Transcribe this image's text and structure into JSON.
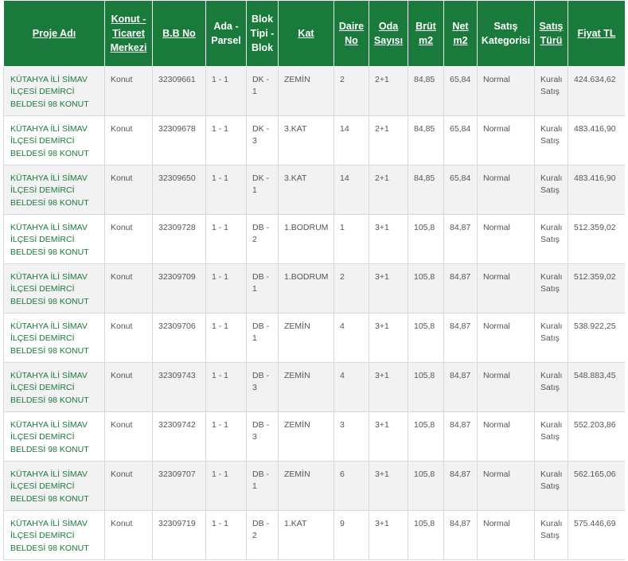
{
  "headers": [
    {
      "key": "proje_adi",
      "label": "Proje Adı",
      "sortable": true
    },
    {
      "key": "konut_ticaret",
      "label": "Konut - Ticaret Merkezi",
      "sortable": true
    },
    {
      "key": "bb_no",
      "label": "B.B No",
      "sortable": true
    },
    {
      "key": "ada_parsel",
      "label": "Ada - Parsel",
      "sortable": false
    },
    {
      "key": "blok",
      "label": "Blok Tipi - Blok",
      "sortable": false
    },
    {
      "key": "kat",
      "label": "Kat",
      "sortable": true
    },
    {
      "key": "daire_no",
      "label": "Daire No",
      "sortable": true
    },
    {
      "key": "oda",
      "label": "Oda Sayısı",
      "sortable": true
    },
    {
      "key": "brut",
      "label": "Brüt m2",
      "sortable": true
    },
    {
      "key": "net",
      "label": "Net m2",
      "sortable": true
    },
    {
      "key": "satis_kat",
      "label": "Satış Kategorisi",
      "sortable": false
    },
    {
      "key": "satis_turu",
      "label": "Satış Türü",
      "sortable": true
    },
    {
      "key": "fiyat",
      "label": "Fiyat TL",
      "sortable": true
    }
  ],
  "rows": [
    {
      "proje_adi": "KÜTAHYA İLİ SİMAV İLÇESİ DEMİRCİ BELDESİ 98 KONUT",
      "konut_ticaret": "Konut",
      "bb_no": "32309661",
      "ada_parsel": "1 - 1",
      "blok": "DK - 1",
      "kat": "ZEMİN",
      "daire_no": "2",
      "oda": "2+1",
      "brut": "84,85",
      "net": "65,84",
      "satis_kat": "Normal",
      "satis_turu": "Kuralı Satış",
      "fiyat": "424.634,62"
    },
    {
      "proje_adi": "KÜTAHYA İLİ SİMAV İLÇESİ DEMİRCİ BELDESİ 98 KONUT",
      "konut_ticaret": "Konut",
      "bb_no": "32309678",
      "ada_parsel": "1 - 1",
      "blok": "DK - 3",
      "kat": "3.KAT",
      "daire_no": "14",
      "oda": "2+1",
      "brut": "84,85",
      "net": "65,84",
      "satis_kat": "Normal",
      "satis_turu": "Kuralı Satış",
      "fiyat": "483.416,90"
    },
    {
      "proje_adi": "KÜTAHYA İLİ SİMAV İLÇESİ DEMİRCİ BELDESİ 98 KONUT",
      "konut_ticaret": "Konut",
      "bb_no": "32309650",
      "ada_parsel": "1 - 1",
      "blok": "DK - 1",
      "kat": "3.KAT",
      "daire_no": "14",
      "oda": "2+1",
      "brut": "84,85",
      "net": "65,84",
      "satis_kat": "Normal",
      "satis_turu": "Kuralı Satış",
      "fiyat": "483.416,90"
    },
    {
      "proje_adi": "KÜTAHYA İLİ SİMAV İLÇESİ DEMİRCİ BELDESİ 98 KONUT",
      "konut_ticaret": "Konut",
      "bb_no": "32309728",
      "ada_parsel": "1 - 1",
      "blok": "DB - 2",
      "kat": "1.BODRUM",
      "daire_no": "1",
      "oda": "3+1",
      "brut": "105,8",
      "net": "84,87",
      "satis_kat": "Normal",
      "satis_turu": "Kuralı Satış",
      "fiyat": "512.359,02"
    },
    {
      "proje_adi": "KÜTAHYA İLİ SİMAV İLÇESİ DEMİRCİ BELDESİ 98 KONUT",
      "konut_ticaret": "Konut",
      "bb_no": "32309709",
      "ada_parsel": "1 - 1",
      "blok": "DB - 1",
      "kat": "1.BODRUM",
      "daire_no": "2",
      "oda": "3+1",
      "brut": "105,8",
      "net": "84,87",
      "satis_kat": "Normal",
      "satis_turu": "Kuralı Satış",
      "fiyat": "512.359,02"
    },
    {
      "proje_adi": "KÜTAHYA İLİ SİMAV İLÇESİ DEMİRCİ BELDESİ 98 KONUT",
      "konut_ticaret": "Konut",
      "bb_no": "32309706",
      "ada_parsel": "1 - 1",
      "blok": "DB - 1",
      "kat": "ZEMİN",
      "daire_no": "4",
      "oda": "3+1",
      "brut": "105,8",
      "net": "84,87",
      "satis_kat": "Normal",
      "satis_turu": "Kuralı Satış",
      "fiyat": "538.922,25"
    },
    {
      "proje_adi": "KÜTAHYA İLİ SİMAV İLÇESİ DEMİRCİ BELDESİ 98 KONUT",
      "konut_ticaret": "Konut",
      "bb_no": "32309743",
      "ada_parsel": "1 - 1",
      "blok": "DB - 3",
      "kat": "ZEMİN",
      "daire_no": "4",
      "oda": "3+1",
      "brut": "105,8",
      "net": "84,87",
      "satis_kat": "Normal",
      "satis_turu": "Kuralı Satış",
      "fiyat": "548.883,45"
    },
    {
      "proje_adi": "KÜTAHYA İLİ SİMAV İLÇESİ DEMİRCİ BELDESİ 98 KONUT",
      "konut_ticaret": "Konut",
      "bb_no": "32309742",
      "ada_parsel": "1 - 1",
      "blok": "DB - 3",
      "kat": "ZEMİN",
      "daire_no": "3",
      "oda": "3+1",
      "brut": "105,8",
      "net": "84,87",
      "satis_kat": "Normal",
      "satis_turu": "Kuralı Satış",
      "fiyat": "552.203,86"
    },
    {
      "proje_adi": "KÜTAHYA İLİ SİMAV İLÇESİ DEMİRCİ BELDESİ 98 KONUT",
      "konut_ticaret": "Konut",
      "bb_no": "32309707",
      "ada_parsel": "1 - 1",
      "blok": "DB - 1",
      "kat": "ZEMİN",
      "daire_no": "6",
      "oda": "3+1",
      "brut": "105,8",
      "net": "84,87",
      "satis_kat": "Normal",
      "satis_turu": "Kuralı Satış",
      "fiyat": "562.165,06"
    },
    {
      "proje_adi": "KÜTAHYA İLİ SİMAV İLÇESİ DEMİRCİ BELDESİ 98 KONUT",
      "konut_ticaret": "Konut",
      "bb_no": "32309719",
      "ada_parsel": "1 - 1",
      "blok": "DB - 2",
      "kat": "1.KAT",
      "daire_no": "9",
      "oda": "3+1",
      "brut": "105,8",
      "net": "84,87",
      "satis_kat": "Normal",
      "satis_turu": "Kuralı Satış",
      "fiyat": "575.446,69"
    }
  ],
  "colors": {
    "header_bg": "#1a7a3b",
    "project_text": "#1a7a3b",
    "cell_text": "#555555",
    "stripe": "#f2f2f2"
  }
}
